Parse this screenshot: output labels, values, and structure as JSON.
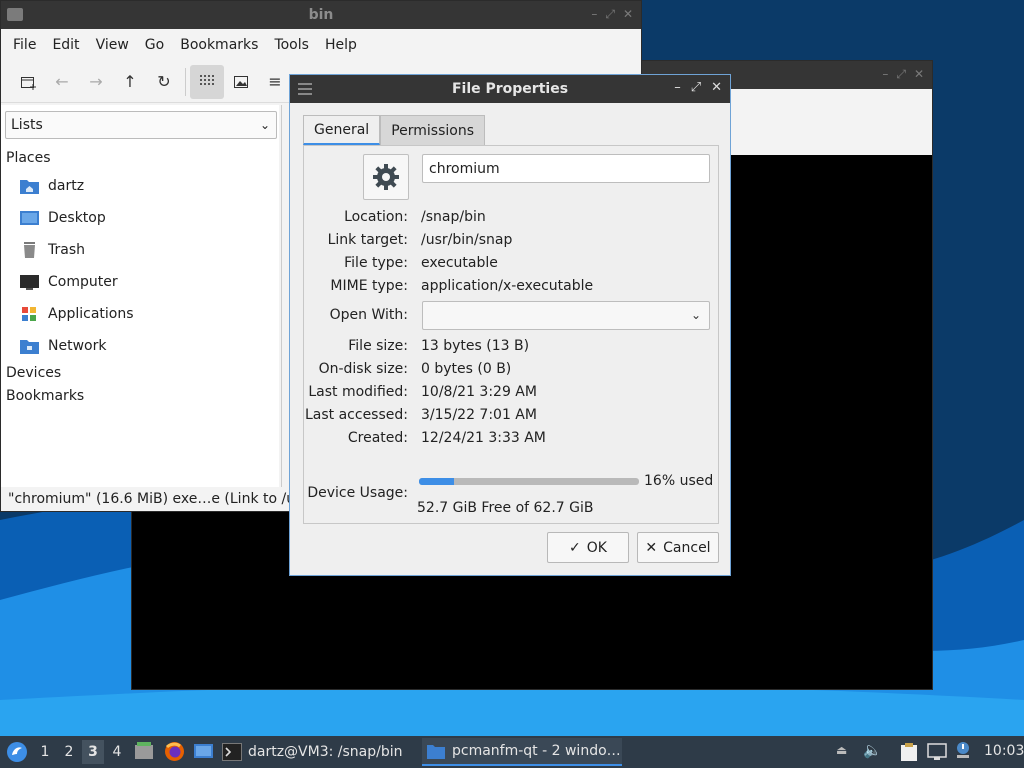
{
  "file_manager": {
    "title": "bin",
    "menu": [
      "File",
      "Edit",
      "View",
      "Go",
      "Bookmarks",
      "Tools",
      "Help"
    ],
    "sidebar_mode": "Lists",
    "places_header": "Places",
    "places": [
      "dartz",
      "Desktop",
      "Trash",
      "Computer",
      "Applications",
      "Network"
    ],
    "devices_header": "Devices",
    "bookmarks_header": "Bookmarks",
    "status": "\"chromium\" (16.6 MiB) exe…e (Link to /us"
  },
  "dialog": {
    "title": "File Properties",
    "tabs": [
      "General",
      "Permissions"
    ],
    "file_name": "chromium",
    "labels": {
      "location": "Location:",
      "link_target": "Link target:",
      "file_type": "File type:",
      "mime_type": "MIME type:",
      "open_with": "Open With:",
      "file_size": "File size:",
      "on_disk_size": "On-disk size:",
      "last_modified": "Last modified:",
      "last_accessed": "Last accessed:",
      "created": "Created:",
      "device_usage": "Device Usage:"
    },
    "values": {
      "location": "/snap/bin",
      "link_target": "/usr/bin/snap",
      "file_type": "executable",
      "mime_type": "application/x-executable",
      "open_with": "",
      "file_size": "13 bytes (13 B)",
      "on_disk_size": "0 bytes (0 B)",
      "last_modified": "10/8/21 3:29 AM",
      "last_accessed": "3/15/22 7:01 AM",
      "created": "12/24/21 3:33 AM"
    },
    "device_usage_fraction": 0.16,
    "device_usage_text": "16% used",
    "free_text": "52.7 GiB Free of 62.7 GiB",
    "ok_label": "OK",
    "cancel_label": "Cancel"
  },
  "taskbar": {
    "workspaces": [
      "1",
      "2",
      "3",
      "4"
    ],
    "active_workspace": "3",
    "terminal_task": "dartz@VM3: /snap/bin",
    "file_manager_task": "pcmanfm-qt - 2 windo…",
    "clock": "10:03"
  },
  "colors": {
    "accent": "#3d8ee6",
    "titlebar": "#353535",
    "taskbar": "#2e3b48"
  }
}
